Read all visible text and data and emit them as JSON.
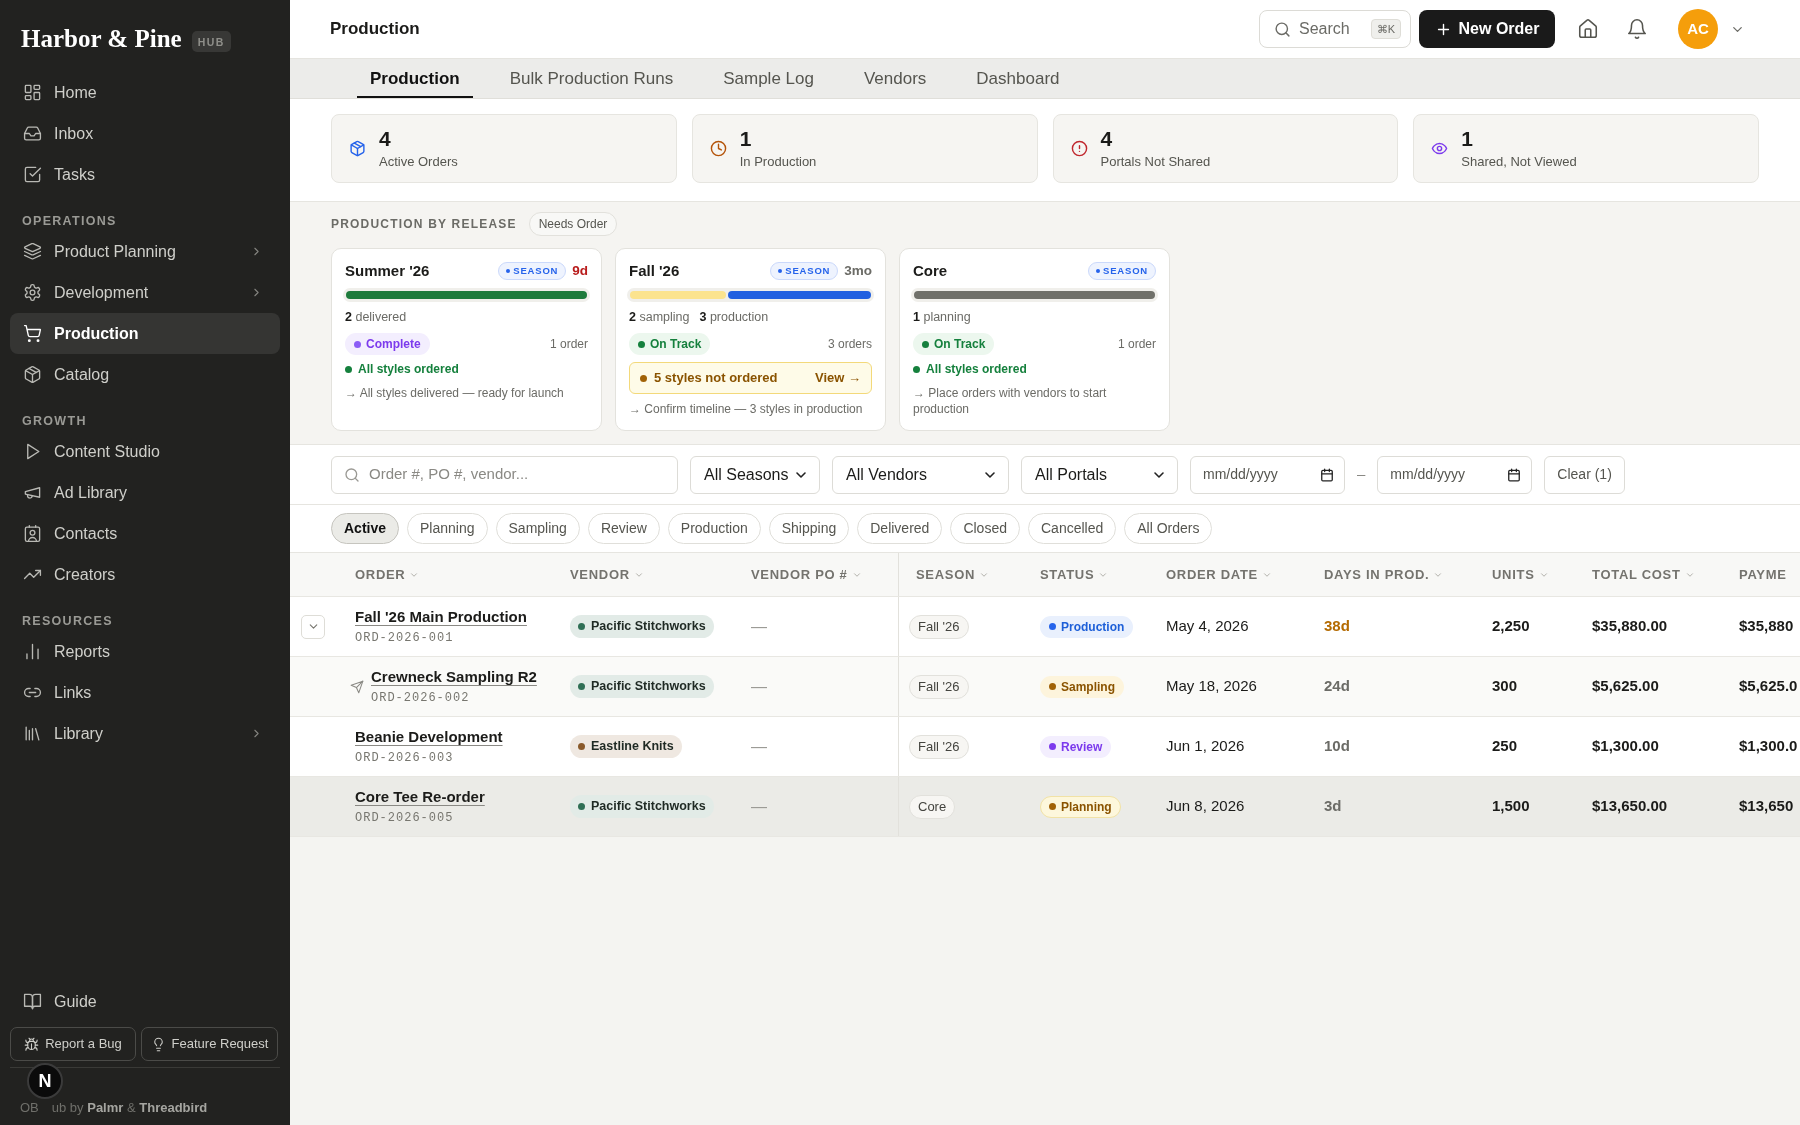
{
  "sidebar": {
    "brand": "Harbor & Pine",
    "brand_badge": "HUB",
    "sections": [
      {
        "items": [
          {
            "label": "Home",
            "selected": false,
            "submenu": false
          },
          {
            "label": "Inbox",
            "selected": false,
            "submenu": false
          },
          {
            "label": "Tasks",
            "selected": false,
            "submenu": false
          }
        ]
      },
      {
        "title": "OPERATIONS",
        "items": [
          {
            "label": "Product Planning",
            "selected": false,
            "submenu": true
          },
          {
            "label": "Development",
            "selected": false,
            "submenu": true
          },
          {
            "label": "Production",
            "selected": true,
            "submenu": false
          },
          {
            "label": "Catalog",
            "selected": false,
            "submenu": false
          }
        ]
      },
      {
        "title": "GROWTH",
        "items": [
          {
            "label": "Content Studio",
            "selected": false,
            "submenu": false
          },
          {
            "label": "Ad Library",
            "selected": false,
            "submenu": false
          },
          {
            "label": "Contacts",
            "selected": false,
            "submenu": false
          },
          {
            "label": "Creators",
            "selected": false,
            "submenu": false
          }
        ]
      },
      {
        "title": "RESOURCES",
        "items": [
          {
            "label": "Reports",
            "selected": false,
            "submenu": false
          },
          {
            "label": "Links",
            "selected": false,
            "submenu": false
          },
          {
            "label": "Library",
            "selected": false,
            "submenu": true
          }
        ]
      }
    ],
    "footer_items": [
      {
        "label": "Guide",
        "selected": false,
        "submenu": false
      }
    ],
    "footer_buttons": [
      "Report a Bug",
      "Feature Request"
    ],
    "credit": [
      "OB",
      "ub by **Palmr** & **Threadbird**"
    ],
    "dev_badge": "N"
  },
  "header": {
    "title": "Production",
    "search": {
      "placeholder": "Search",
      "shortcut": "⌘K"
    },
    "new_button": "New Order",
    "avatar": "AC"
  },
  "tabs": [
    {
      "label": "Production",
      "selected": true
    },
    {
      "label": "Bulk Production Runs",
      "selected": false
    },
    {
      "label": "Sample Log",
      "selected": false
    },
    {
      "label": "Vendors",
      "selected": false
    },
    {
      "label": "Dashboard",
      "selected": false
    }
  ],
  "stats": [
    {
      "value": "4",
      "label": "Active Orders",
      "color": "#2563eb"
    },
    {
      "value": "1",
      "label": "In Production",
      "color": "#b45309"
    },
    {
      "value": "4",
      "label": "Portals Not Shared",
      "color": "#c0262d"
    },
    {
      "value": "1",
      "label": "Shared, Not Viewed",
      "color": "#7c3aed"
    }
  ],
  "release_section": {
    "title": "PRODUCTION BY RELEASE",
    "filter": "Needs Order",
    "releases": [
      {
        "name": "Summer '26",
        "badge": "SEASON",
        "time_left": "9d",
        "urgent": true,
        "progress": [
          {
            "level": 1,
            "color": "#1e7b3c"
          }
        ],
        "counts": [
          "**2** delivered"
        ],
        "status": {
          "label": "Complete",
          "kind": "complete"
        },
        "order_count": "1 order",
        "styles": {
          "kind": "ok",
          "text": "All styles ordered"
        },
        "note": "→ All styles delivered — ready for launch"
      },
      {
        "name": "Fall '26",
        "badge": "SEASON",
        "time_left": "3mo",
        "urgent": false,
        "progress": [
          {
            "level": 0.4,
            "color": "#fbe38e"
          },
          {
            "level": 0.6,
            "color": "#2160e0"
          }
        ],
        "counts": [
          "**2** sampling",
          "**3** production"
        ],
        "status": {
          "label": "On Track",
          "kind": "on_track"
        },
        "order_count": "3 orders",
        "styles": {
          "kind": "warning",
          "text": "5 styles not ordered",
          "action": "View →"
        },
        "note": "→ Confirm timeline — 3 styles in production"
      },
      {
        "name": "Core",
        "badge": "SEASON",
        "progress": [
          {
            "level": 1,
            "color": "#70706a"
          }
        ],
        "counts": [
          "**1** planning"
        ],
        "status": {
          "label": "On Track",
          "kind": "on_track"
        },
        "order_count": "1 order",
        "styles": {
          "kind": "ok",
          "text": "All styles ordered"
        },
        "note": "→ Place orders with vendors to start production"
      }
    ]
  },
  "filters": {
    "search": {
      "placeholder": "Order #, PO #, vendor..."
    },
    "dropdowns": [
      "All Seasons",
      "All Vendors",
      "All Portals"
    ],
    "date_from": {
      "placeholder": "mm/dd/yyyy"
    },
    "date_separator": "–",
    "date_to": {
      "placeholder": "mm/dd/yyyy"
    },
    "clear": "Clear (1)"
  },
  "status_filters": [
    {
      "label": "Active",
      "selected": true
    },
    {
      "label": "Planning",
      "selected": false
    },
    {
      "label": "Sampling",
      "selected": false
    },
    {
      "label": "Review",
      "selected": false
    },
    {
      "label": "Production",
      "selected": false
    },
    {
      "label": "Shipping",
      "selected": false
    },
    {
      "label": "Delivered",
      "selected": false
    },
    {
      "label": "Closed",
      "selected": false
    },
    {
      "label": "Cancelled",
      "selected": false
    },
    {
      "label": "All Orders",
      "selected": false
    }
  ],
  "table": {
    "columns": [
      {
        "label": "ORDER",
        "sortable": true
      },
      {
        "label": "VENDOR",
        "sortable": true
      },
      {
        "label": "VENDOR PO #",
        "sortable": true
      },
      {
        "label": "SEASON",
        "sortable": true
      },
      {
        "label": "STATUS",
        "sortable": true
      },
      {
        "label": "ORDER DATE",
        "sortable": true
      },
      {
        "label": "DAYS IN PROD.",
        "sortable": true
      },
      {
        "label": "UNITS",
        "sortable": true
      },
      {
        "label": "TOTAL COST",
        "sortable": true
      },
      {
        "label": "PAYME",
        "sortable": false
      }
    ],
    "rows": [
      {
        "name": "Fall '26 Main Production",
        "number": "ORD-2026-001",
        "vendor": {
          "name": "Pacific Stitchworks",
          "color": "#2f6f55"
        },
        "vendor_po": "—",
        "season": "Fall '26",
        "status": {
          "label": "Production",
          "kind": "production"
        },
        "order_date": "May 4, 2026",
        "days": "38d",
        "days_alert": true,
        "units": "2,250",
        "total_cost": "$35,880.00",
        "payment": "$35,880",
        "hovered": false,
        "expanded": true,
        "children": [
          {
            "name": "Crewneck Sampling R2",
            "number": "ORD-2026-002",
            "vendor": {
              "name": "Pacific Stitchworks",
              "color": "#2f6f55"
            },
            "vendor_po": "—",
            "season": "Fall '26",
            "status": {
              "label": "Sampling",
              "kind": "sampling"
            },
            "order_date": "May 18, 2026",
            "days": "24d",
            "days_alert": false,
            "units": "300",
            "total_cost": "$5,625.00",
            "payment": "$5,625.0",
            "hovered": false
          }
        ]
      },
      {
        "name": "Beanie Development",
        "number": "ORD-2026-003",
        "vendor": {
          "name": "Eastline Knits",
          "color": "#8a5a2b"
        },
        "vendor_po": "—",
        "season": "Fall '26",
        "status": {
          "label": "Review",
          "kind": "review"
        },
        "order_date": "Jun 1, 2026",
        "days": "10d",
        "days_alert": false,
        "units": "250",
        "total_cost": "$1,300.00",
        "payment": "$1,300.0",
        "hovered": false
      },
      {
        "name": "Core Tee Re-order",
        "number": "ORD-2026-005",
        "vendor": {
          "name": "Pacific Stitchworks",
          "color": "#2f6f55"
        },
        "vendor_po": "—",
        "season": "Core",
        "status": {
          "label": "Planning",
          "kind": "planning"
        },
        "order_date": "Jun 8, 2026",
        "days": "3d",
        "days_alert": false,
        "units": "1,500",
        "total_cost": "$13,650.00",
        "payment": "$13,650",
        "hovered": true
      }
    ]
  }
}
